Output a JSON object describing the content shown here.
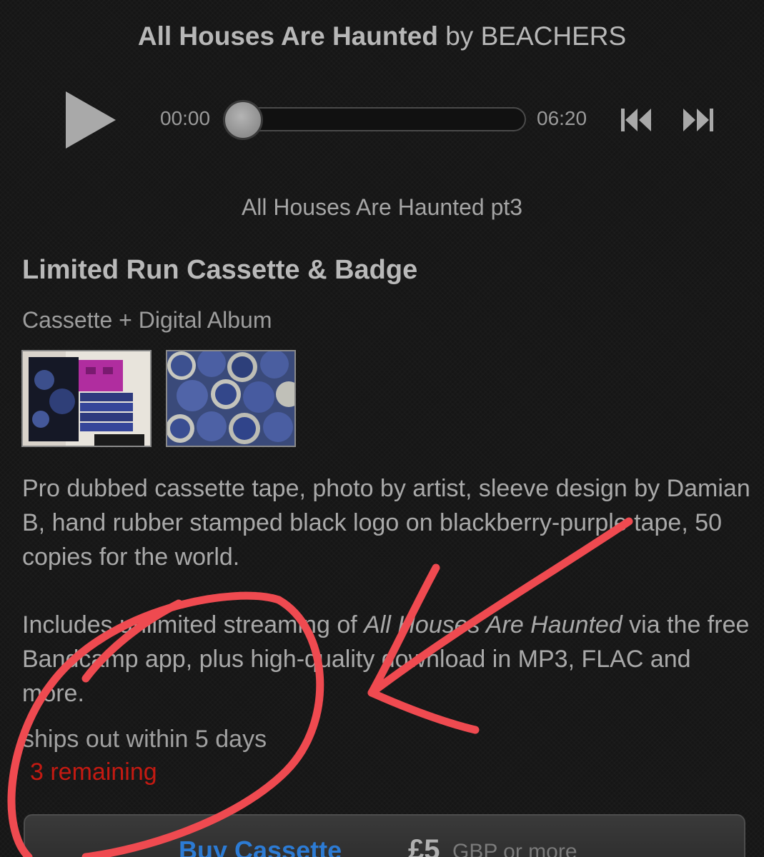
{
  "header": {
    "album": "All Houses Are Haunted",
    "by": "by",
    "artist": "BEACHERS"
  },
  "player": {
    "current_time": "00:00",
    "total_time": "06:20",
    "progress": 0,
    "track_name": "All Houses Are Haunted pt3"
  },
  "package": {
    "title": "Limited Run Cassette & Badge",
    "subtitle": "Cassette + Digital Album",
    "images": [
      "cassette-photo",
      "badges-photo"
    ],
    "description_1": "Pro dubbed cassette tape, photo by artist, sleeve design by Damian B, hand rubber stamped black logo on blackberry-purple tape, 50 copies for the world.",
    "description_2_prefix": "Includes unlimited streaming of ",
    "description_2_album": "All Houses Are Haunted",
    "description_2_suffix": " via the free Bandcamp app, plus high-quality download in MP3, FLAC and more.",
    "ships": "ships out within 5 days",
    "remaining": "3 remaining"
  },
  "buy": {
    "label": "Buy Cassette",
    "price": "£5",
    "currency": "GBP or more"
  },
  "colors": {
    "background": "#161616",
    "text": "#a9a9a9",
    "remaining": "#c41a12",
    "link": "#2c7bd4",
    "annotation": "#ef4a50"
  }
}
